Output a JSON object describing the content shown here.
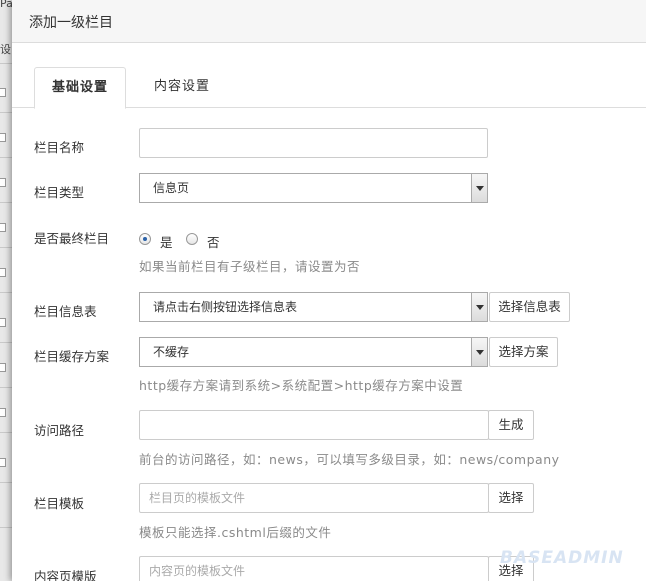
{
  "modal": {
    "title": "添加一级栏目"
  },
  "tabs": [
    {
      "label": "基础设置"
    },
    {
      "label": "内容设置"
    }
  ],
  "form": {
    "name": {
      "label": "栏目名称",
      "value": ""
    },
    "type": {
      "label": "栏目类型",
      "selected": "信息页"
    },
    "is_final": {
      "label": "是否最终栏目",
      "options": [
        {
          "label": "是",
          "checked": true
        },
        {
          "label": "否",
          "checked": false
        }
      ],
      "help": "如果当前栏目有子级栏目，请设置为否"
    },
    "info_table": {
      "label": "栏目信息表",
      "selected": "请点击右侧按钮选择信息表",
      "button": "选择信息表"
    },
    "cache": {
      "label": "栏目缓存方案",
      "selected": "不缓存",
      "button": "选择方案",
      "help": "http缓存方案请到系统>系统配置>http缓存方案中设置"
    },
    "path": {
      "label": "访问路径",
      "value": "",
      "button": "生成",
      "help": "前台的访问路径，如：news，可以填写多级目录，如：news/company"
    },
    "template": {
      "label": "栏目模板",
      "placeholder": "栏目页的模板文件",
      "button": "选择",
      "help": "模板只能选择.cshtml后缀的文件"
    },
    "content_template": {
      "label": "内容页模版",
      "placeholder": "内容页的模板文件",
      "button": "选择"
    }
  },
  "watermark": "BASEADMIN",
  "background": {
    "fragment_top": "Pa",
    "fragment_side": "设"
  }
}
